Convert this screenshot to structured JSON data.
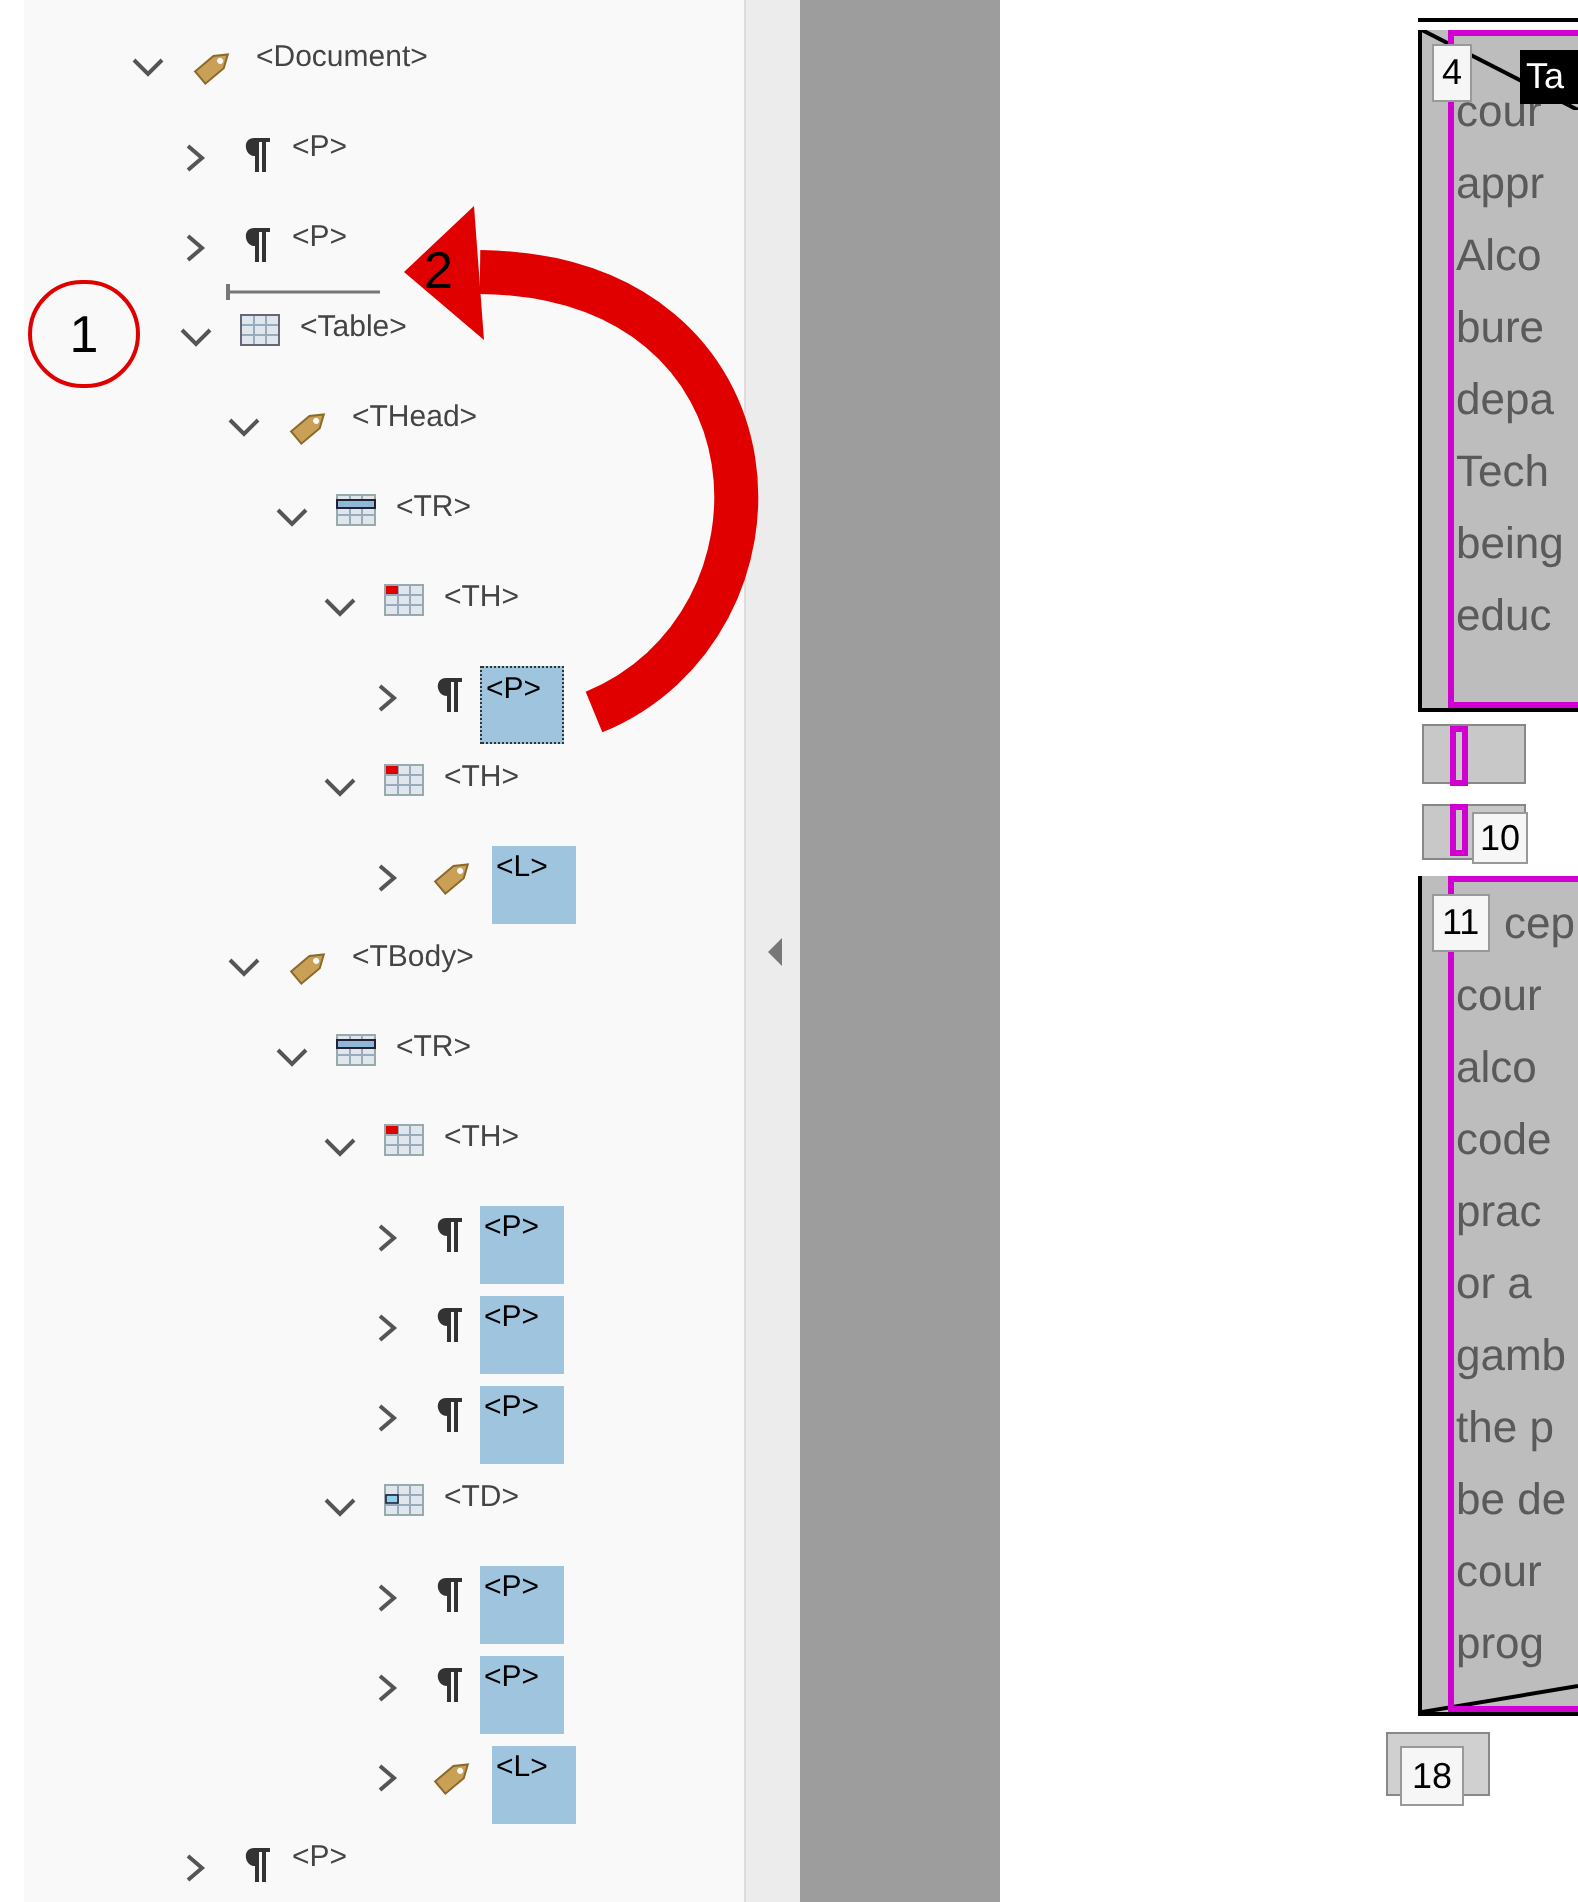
{
  "tag_tree": {
    "items": [
      {
        "label": "<Document>",
        "kind": "tag",
        "expanded": true,
        "selected": false,
        "focused": false,
        "children": [
          {
            "label": "<P>",
            "kind": "paragraph",
            "expanded": false,
            "selected": false,
            "focused": false
          },
          {
            "label": "<P>",
            "kind": "paragraph",
            "expanded": false,
            "selected": false,
            "focused": false
          },
          {
            "label": "<Table>",
            "kind": "table",
            "expanded": true,
            "selected": false,
            "focused": false,
            "children": [
              {
                "label": "<THead>",
                "kind": "tag",
                "expanded": true,
                "selected": false,
                "focused": false,
                "children": [
                  {
                    "label": "<TR>",
                    "kind": "row",
                    "expanded": true,
                    "selected": false,
                    "focused": false,
                    "children": [
                      {
                        "label": "<TH>",
                        "kind": "header_cell",
                        "expanded": true,
                        "selected": false,
                        "focused": false,
                        "children": [
                          {
                            "label": "<P>",
                            "kind": "paragraph",
                            "expanded": false,
                            "selected": true,
                            "focused": true
                          }
                        ]
                      },
                      {
                        "label": "<TH>",
                        "kind": "header_cell",
                        "expanded": true,
                        "selected": false,
                        "focused": false,
                        "children": [
                          {
                            "label": "<L>",
                            "kind": "tag",
                            "expanded": false,
                            "selected": true,
                            "focused": false
                          }
                        ]
                      }
                    ]
                  }
                ]
              },
              {
                "label": "<TBody>",
                "kind": "tag",
                "expanded": true,
                "selected": false,
                "focused": false,
                "children": [
                  {
                    "label": "<TR>",
                    "kind": "row",
                    "expanded": true,
                    "selected": false,
                    "focused": false,
                    "children": [
                      {
                        "label": "<TH>",
                        "kind": "header_cell",
                        "expanded": true,
                        "selected": false,
                        "focused": false,
                        "children": [
                          {
                            "label": "<P>",
                            "kind": "paragraph",
                            "expanded": false,
                            "selected": true,
                            "focused": false
                          },
                          {
                            "label": "<P>",
                            "kind": "paragraph",
                            "expanded": false,
                            "selected": true,
                            "focused": false
                          },
                          {
                            "label": "<P>",
                            "kind": "paragraph",
                            "expanded": false,
                            "selected": true,
                            "focused": false
                          }
                        ]
                      },
                      {
                        "label": "<TD>",
                        "kind": "data_cell",
                        "expanded": true,
                        "selected": false,
                        "focused": false,
                        "children": [
                          {
                            "label": "<P>",
                            "kind": "paragraph",
                            "expanded": false,
                            "selected": true,
                            "focused": false
                          },
                          {
                            "label": "<P>",
                            "kind": "paragraph",
                            "expanded": false,
                            "selected": true,
                            "focused": false
                          },
                          {
                            "label": "<L>",
                            "kind": "tag",
                            "expanded": false,
                            "selected": true,
                            "focused": false
                          }
                        ]
                      }
                    ]
                  }
                ]
              }
            ]
          },
          {
            "label": "<P>",
            "kind": "paragraph",
            "expanded": false,
            "selected": false,
            "focused": false
          }
        ]
      }
    ]
  },
  "annotations": [
    {
      "kind": "circle",
      "label": "1"
    },
    {
      "kind": "arrow",
      "label": "2"
    }
  ],
  "page_view": {
    "tooltip": "Ta",
    "cells": [
      {
        "number": "4",
        "lines": [
          "cour",
          "appr",
          "Alco",
          "bure",
          "depa",
          "Tech",
          "being",
          "educ"
        ]
      },
      {
        "number": "11",
        "lines": [
          "cep",
          "cour",
          "alco",
          "code",
          "prac",
          "or a",
          "gamb",
          "the p",
          "be de",
          "cour",
          "prog"
        ]
      }
    ],
    "middle_marker": "10",
    "bottom_marker": "18"
  }
}
